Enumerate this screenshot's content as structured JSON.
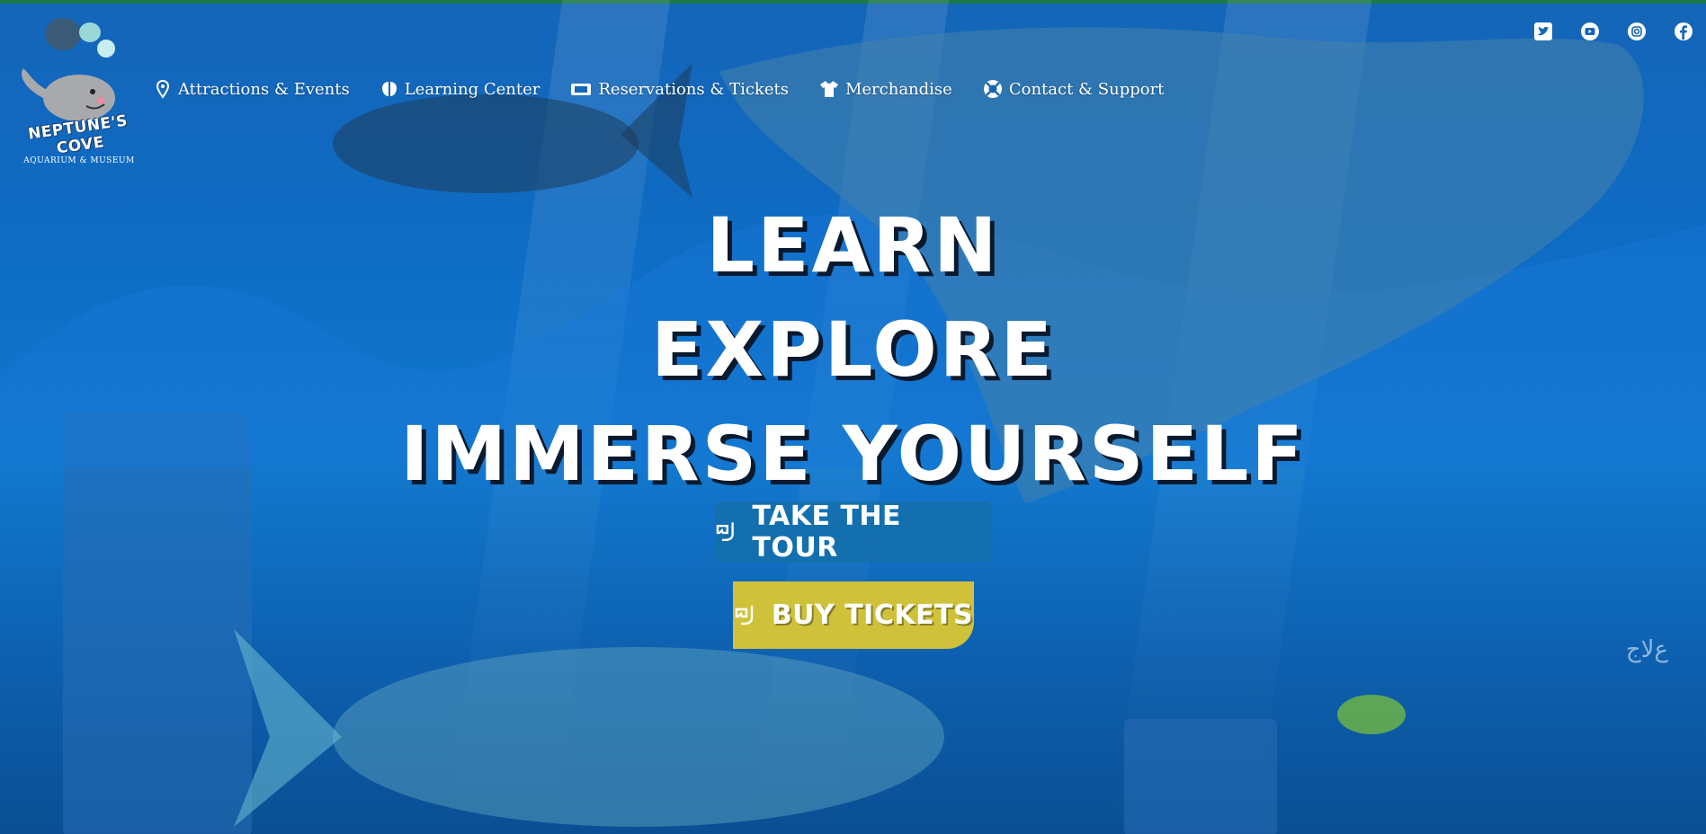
{
  "colors": {
    "top_strip": "#1b7a4a",
    "water": "#0e6cc4",
    "buy_button": "#cfc23a",
    "tour_button": "#146eaa",
    "text": "#ffffff"
  },
  "brand": {
    "name": "NEPTUNE'S COVE",
    "subtitle": "AQUARIUM & MUSEUM",
    "logo_icon": "whale-logo"
  },
  "nav": {
    "items": [
      {
        "label": "Attractions & Events",
        "icon": "map-pin-icon"
      },
      {
        "label": "Learning Center",
        "icon": "brain-icon"
      },
      {
        "label": "Reservations & Tickets",
        "icon": "ticket-icon"
      },
      {
        "label": "Merchandise",
        "icon": "tshirt-icon"
      },
      {
        "label": "Contact & Support",
        "icon": "life-ring-icon"
      }
    ]
  },
  "social": [
    "twitter-icon",
    "youtube-icon",
    "instagram-icon",
    "facebook-icon"
  ],
  "hero": {
    "lines": [
      "LEARN",
      "EXPLORE",
      "IMMERSE YOURSELF"
    ],
    "tour_button": "TAKE THE TOUR",
    "tickets_button": "BUY TICKETS",
    "button_icon": "snorkel-mask-icon"
  },
  "watermark": "ﻉﻻﺝ"
}
